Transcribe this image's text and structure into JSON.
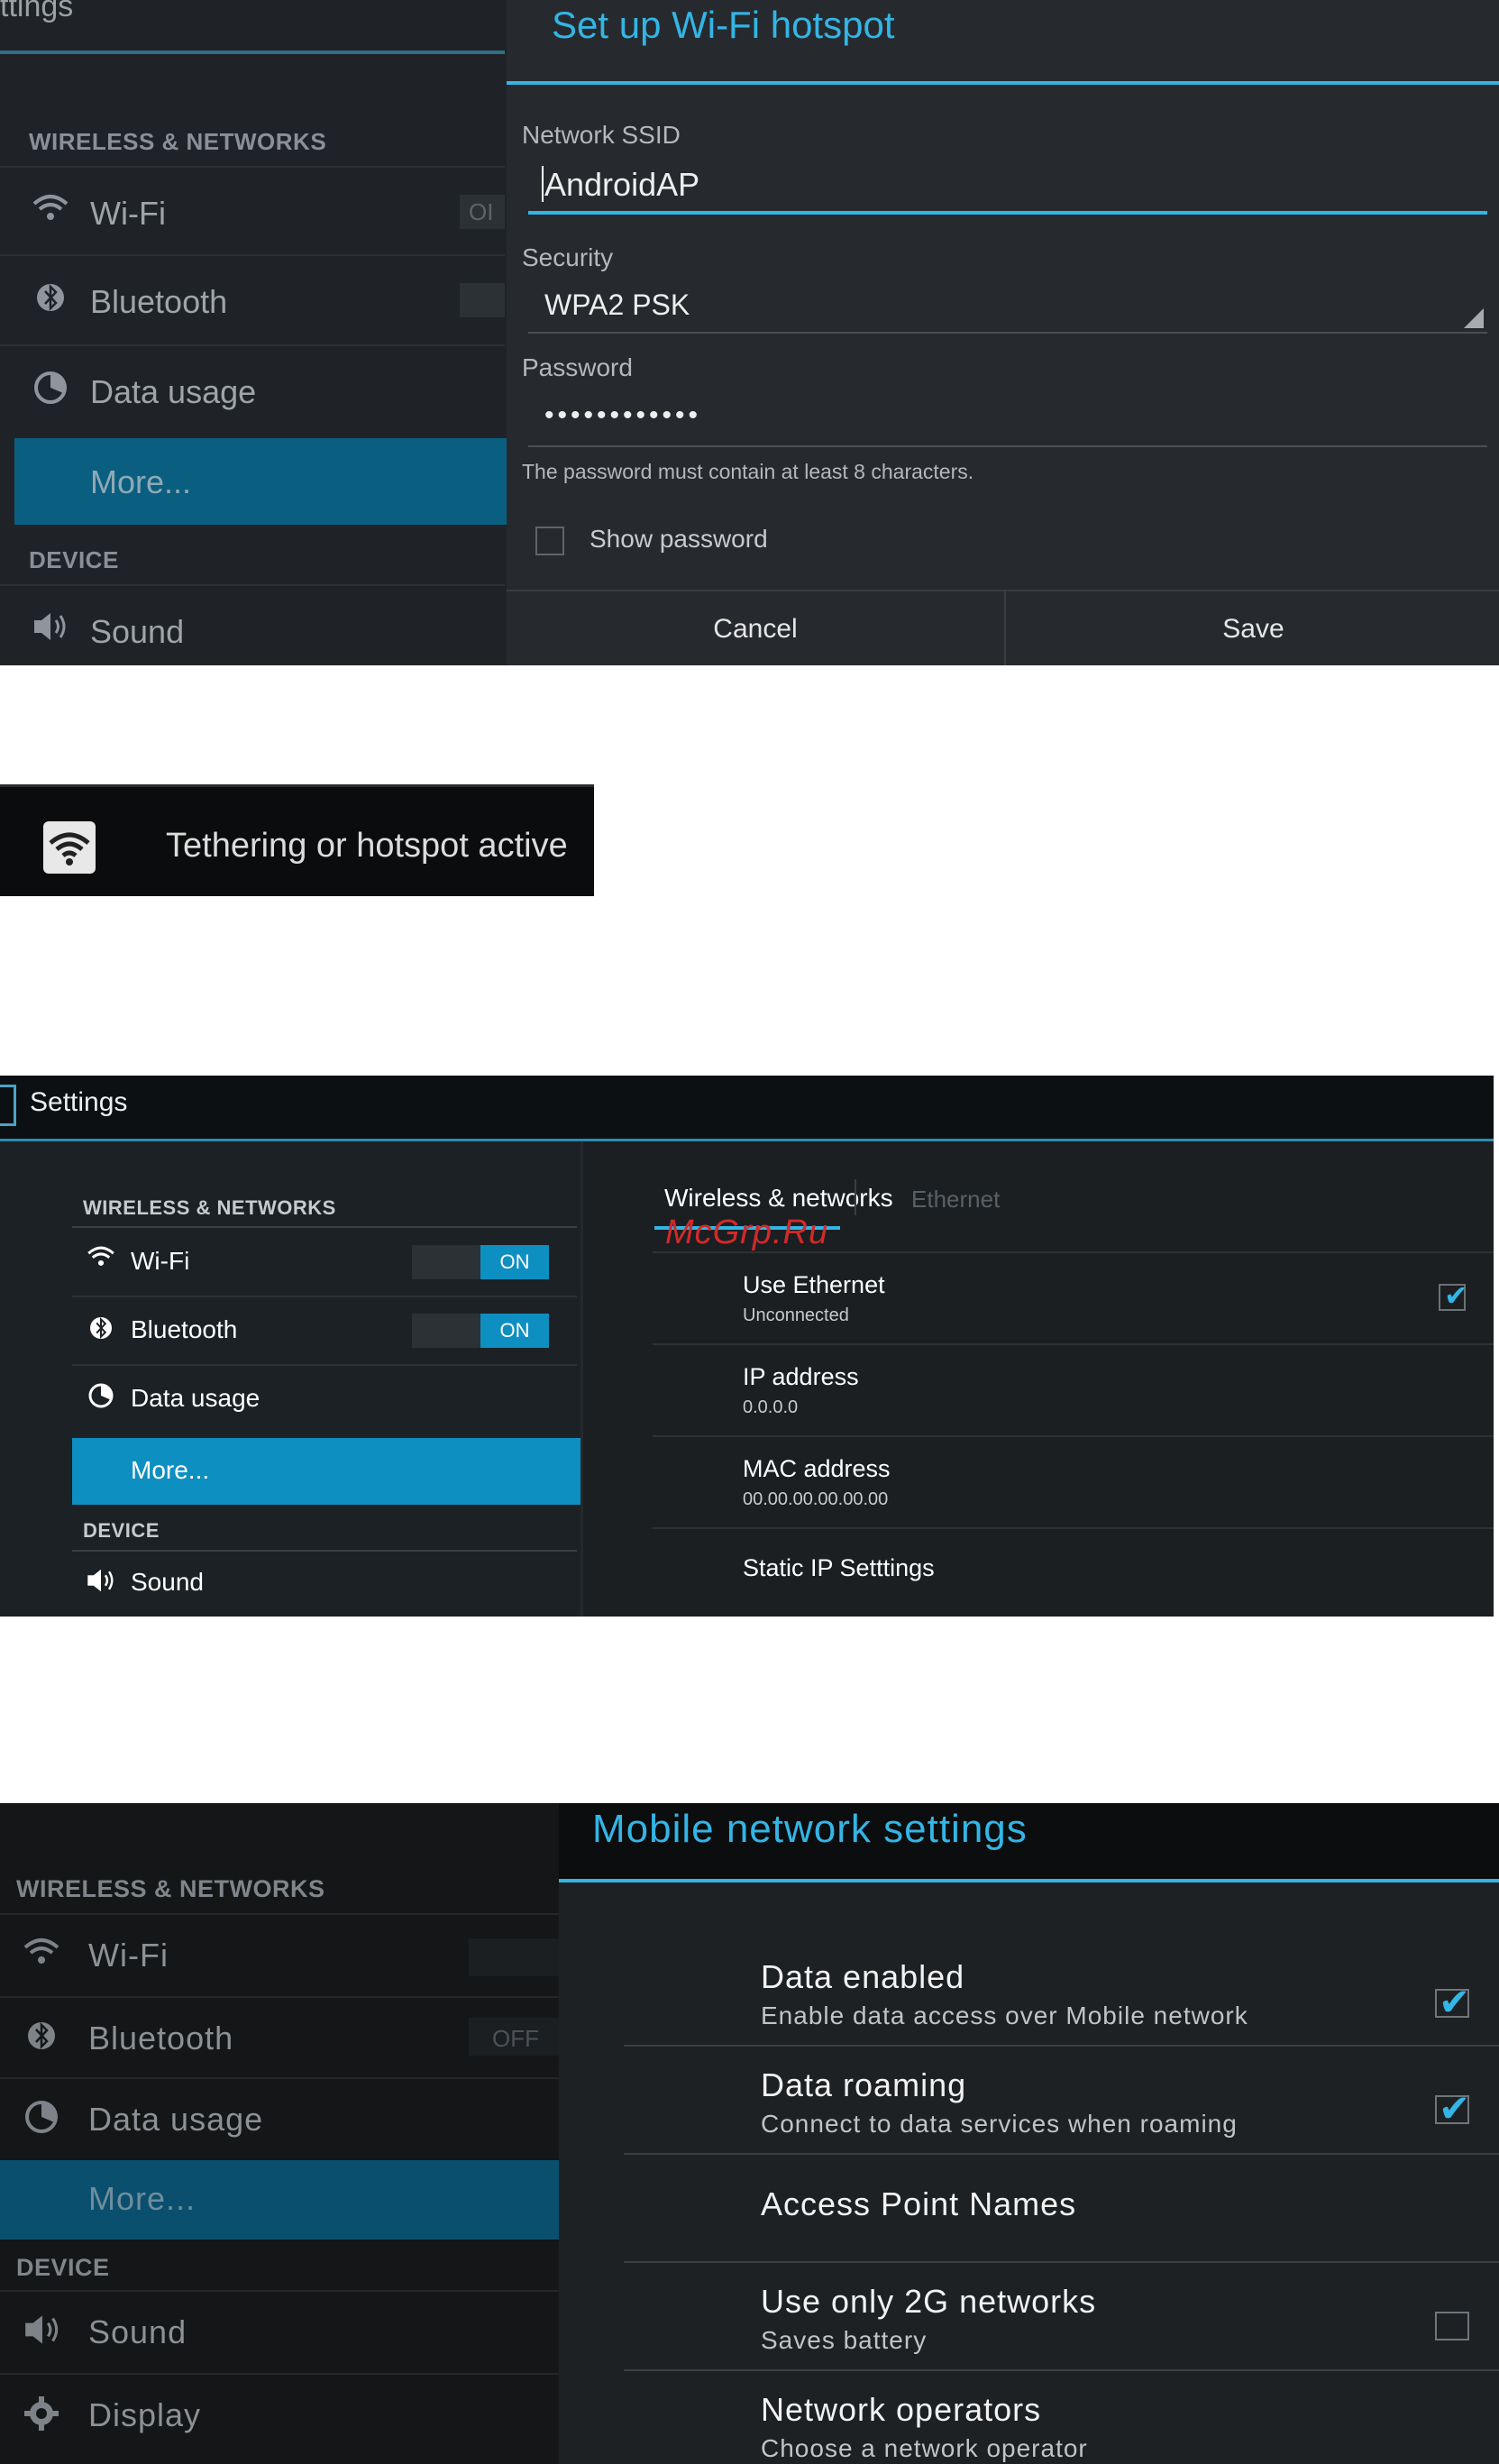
{
  "panel1": {
    "breadcrumb": "ttings",
    "sidebar": {
      "section_wireless": "WIRELESS & NETWORKS",
      "items": [
        {
          "label": "Wi-Fi",
          "icon": "wifi-icon",
          "toggle": "OI"
        },
        {
          "label": "Bluetooth",
          "icon": "bluetooth-icon"
        },
        {
          "label": "Data usage",
          "icon": "data-usage-icon"
        },
        {
          "label": "More..."
        }
      ],
      "section_device": "DEVICE",
      "device_items": [
        {
          "label": "Sound",
          "icon": "speaker-icon"
        }
      ]
    },
    "dialog": {
      "title": "Set up Wi-Fi hotspot",
      "ssid_label": "Network SSID",
      "ssid_value": "AndroidAP",
      "security_label": "Security",
      "security_value": "WPA2 PSK",
      "password_label": "Password",
      "password_value": "••••••••••••",
      "password_hint": "The password must contain at least 8 characters.",
      "show_password": "Show password",
      "cancel": "Cancel",
      "save": "Save"
    }
  },
  "notification": {
    "icon": "hotspot-icon",
    "text": "Tethering or hotspot active"
  },
  "panel3": {
    "app_title": "Settings",
    "sidebar": {
      "section_wireless": "WIRELESS & NETWORKS",
      "items": [
        {
          "label": "Wi-Fi",
          "icon": "wifi-icon",
          "toggle": "ON"
        },
        {
          "label": "Bluetooth",
          "icon": "bluetooth-icon",
          "toggle": "ON"
        },
        {
          "label": "Data usage",
          "icon": "data-usage-icon"
        },
        {
          "label": "More..."
        }
      ],
      "section_device": "DEVICE",
      "device_items": [
        {
          "label": "Sound",
          "icon": "speaker-icon"
        }
      ]
    },
    "tabs": [
      "Wireless & networks",
      "Ethernet"
    ],
    "watermark": "McGrp.Ru",
    "rows": [
      {
        "title": "Use Ethernet",
        "sub": "Unconnected",
        "checked": true
      },
      {
        "title": "IP address",
        "sub": "0.0.0.0"
      },
      {
        "title": "MAC address",
        "sub": "00.00.00.00.00.00"
      },
      {
        "title": "Static IP Setttings",
        "sub": ""
      }
    ],
    "accent": "#33b5e5"
  },
  "panel4": {
    "sidebar": {
      "section_wireless": "WIRELESS & NETWORKS",
      "items": [
        {
          "label": "Wi-Fi",
          "icon": "wifi-icon"
        },
        {
          "label": "Bluetooth",
          "icon": "bluetooth-icon",
          "toggle": "OFF"
        },
        {
          "label": "Data usage",
          "icon": "data-usage-icon"
        },
        {
          "label": "More..."
        }
      ],
      "section_device": "DEVICE",
      "device_items": [
        {
          "label": "Sound",
          "icon": "speaker-icon"
        },
        {
          "label": "Display",
          "icon": "display-gear-icon"
        }
      ]
    },
    "title": "Mobile network settings",
    "rows": [
      {
        "title": "Data enabled",
        "sub": "Enable data access over Mobile network",
        "checked": true
      },
      {
        "title": "Data roaming",
        "sub": "Connect to data services when roaming",
        "checked": true
      },
      {
        "title": "Access Point Names",
        "sub": ""
      },
      {
        "title": "Use only 2G networks",
        "sub": "Saves battery",
        "checked": false
      },
      {
        "title": "Network operators",
        "sub": "Choose a network operator"
      }
    ]
  }
}
